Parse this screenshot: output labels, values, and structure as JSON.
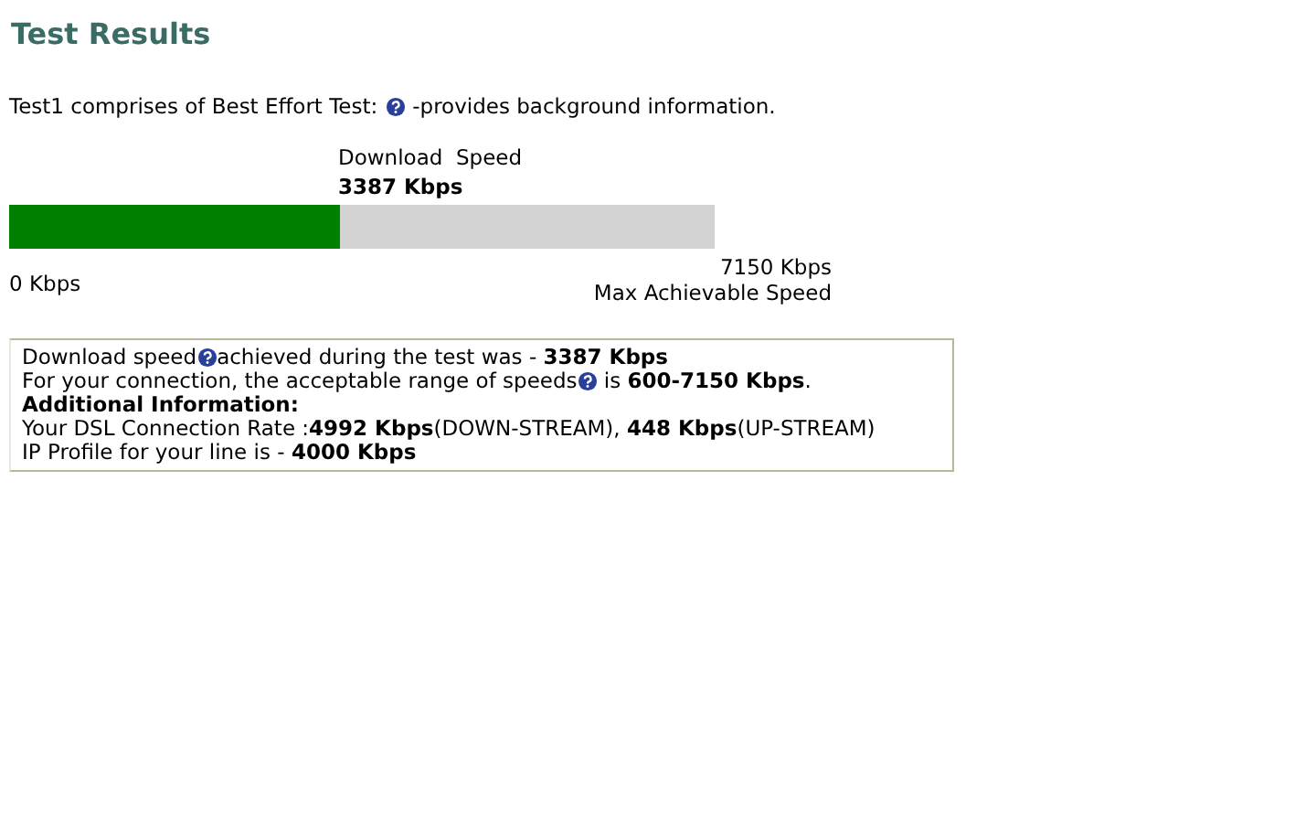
{
  "title": "Test Results",
  "intro": {
    "before": "Test1 comprises of Best Effort Test:",
    "after": "-provides background information."
  },
  "meter": {
    "label": "Download  Speed",
    "value": "3387 Kbps",
    "level": 0.47,
    "min_label": "0 Kbps",
    "max_value": "7150 Kbps",
    "max_label": "Max Achievable Speed"
  },
  "info_lines": [
    {
      "parts": [
        {
          "kind": "text",
          "text": "Download speed"
        },
        {
          "kind": "help"
        },
        {
          "kind": "text",
          "text": "achieved during the test was - **3387 Kbps**"
        }
      ]
    },
    {
      "parts": [
        {
          "kind": "text",
          "text": "For your connection, the acceptable range of speeds"
        },
        {
          "kind": "help"
        },
        {
          "kind": "text",
          "text": " is **600-7150 Kbps**."
        }
      ]
    },
    {
      "parts": [
        {
          "kind": "text",
          "text": "**Additional Information:**"
        }
      ]
    },
    {
      "parts": [
        {
          "kind": "text",
          "text": "Your DSL Connection Rate :**4992 Kbps**(DOWN-STREAM), **448 Kbps**(UP-STREAM)"
        }
      ]
    },
    {
      "parts": [
        {
          "kind": "text",
          "text": "IP Profile for your line is - **4000 Kbps**"
        }
      ]
    }
  ]
}
